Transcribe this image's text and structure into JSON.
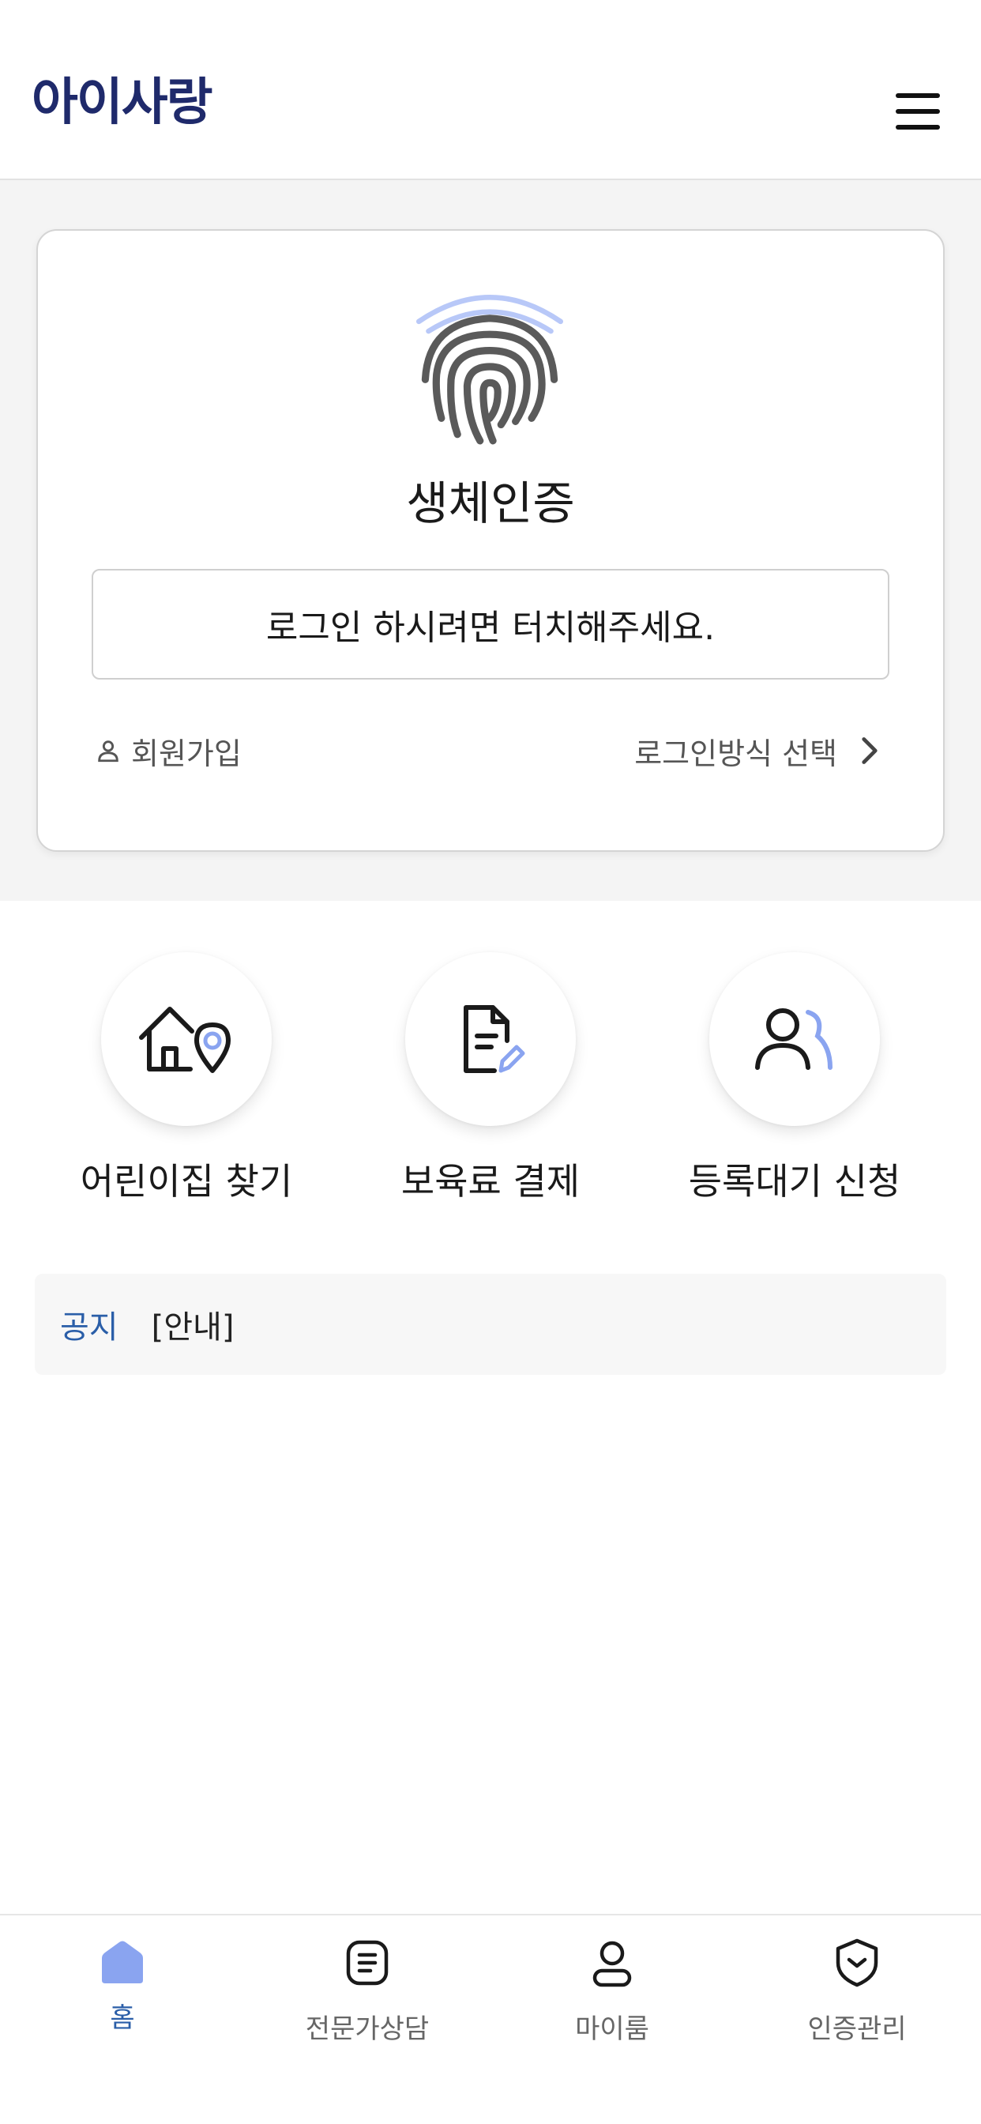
{
  "header": {
    "logo_text": "아이사랑",
    "menu_icon": "hamburger-menu-icon"
  },
  "auth": {
    "icon": "fingerprint-icon",
    "title": "생체인증",
    "touch_prompt": "로그인 하시려면 터치해주세요.",
    "signup_label": "회원가입",
    "login_method_label": "로그인방식 선택"
  },
  "quick_menu": [
    {
      "label": "어린이집 찾기",
      "icon": "house-location-icon"
    },
    {
      "label": "보육료 결제",
      "icon": "document-edit-icon"
    },
    {
      "label": "등록대기 신청",
      "icon": "user-wait-icon"
    }
  ],
  "notice": {
    "tag": "공지",
    "text": "[안내]"
  },
  "bottom_nav": [
    {
      "label": "홈",
      "icon": "home-icon",
      "active": true
    },
    {
      "label": "전문가상담",
      "icon": "consult-document-icon",
      "active": false
    },
    {
      "label": "마이룸",
      "icon": "person-icon",
      "active": false
    },
    {
      "label": "인증관리",
      "icon": "shield-check-icon",
      "active": false
    }
  ],
  "colors": {
    "brand": "#1f2a6b",
    "accent": "#2a5ea8",
    "icon_accent": "#8aa4f0"
  }
}
